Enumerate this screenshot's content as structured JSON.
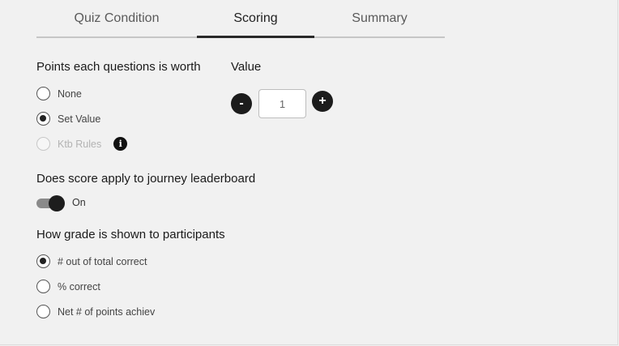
{
  "tabs": [
    {
      "label": "Quiz Condition"
    },
    {
      "label": "Scoring"
    },
    {
      "label": "Summary"
    }
  ],
  "points": {
    "heading": "Points each questions is worth",
    "options": [
      {
        "label": "None",
        "selected": false,
        "disabled": false
      },
      {
        "label": "Set Value",
        "selected": true,
        "disabled": false
      },
      {
        "label": "Ktb Rules",
        "selected": false,
        "disabled": true
      }
    ]
  },
  "value": {
    "heading": "Value",
    "minus_label": "-",
    "plus_label": "+",
    "current": "1"
  },
  "leaderboard": {
    "heading": "Does score apply to journey leaderboard",
    "toggle_label": "On",
    "on": true
  },
  "grade": {
    "heading": "How grade is shown to participants",
    "options": [
      {
        "label": "# out of total correct",
        "selected": true
      },
      {
        "label": "% correct",
        "selected": false
      },
      {
        "label": "Net # of points achiev",
        "selected": false
      }
    ]
  },
  "icons": {
    "info": "info-icon",
    "plus": "plus-icon",
    "minus": "minus-icon"
  }
}
